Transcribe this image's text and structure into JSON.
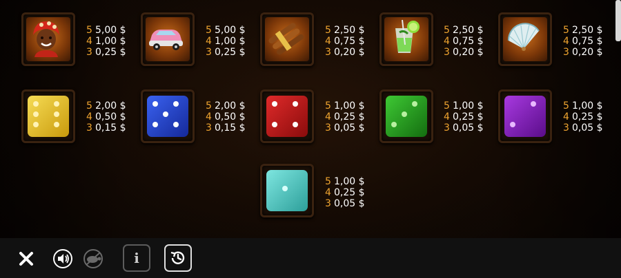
{
  "paytable": {
    "symbols": [
      {
        "id": "woman",
        "payouts": [
          {
            "count": "5",
            "value": "5,00 $"
          },
          {
            "count": "4",
            "value": "1,00 $"
          },
          {
            "count": "3",
            "value": "0,25 $"
          }
        ]
      },
      {
        "id": "car",
        "payouts": [
          {
            "count": "5",
            "value": "5,00 $"
          },
          {
            "count": "4",
            "value": "1,00 $"
          },
          {
            "count": "3",
            "value": "0,25 $"
          }
        ]
      },
      {
        "id": "cigars",
        "payouts": [
          {
            "count": "5",
            "value": "2,50 $"
          },
          {
            "count": "4",
            "value": "0,75 $"
          },
          {
            "count": "3",
            "value": "0,20 $"
          }
        ]
      },
      {
        "id": "mojito",
        "payouts": [
          {
            "count": "5",
            "value": "2,50 $"
          },
          {
            "count": "4",
            "value": "0,75 $"
          },
          {
            "count": "3",
            "value": "0,20 $"
          }
        ]
      },
      {
        "id": "fan",
        "payouts": [
          {
            "count": "5",
            "value": "2,50 $"
          },
          {
            "count": "4",
            "value": "0,75 $"
          },
          {
            "count": "3",
            "value": "0,20 $"
          }
        ]
      },
      {
        "id": "die-yellow",
        "color": "#e8c21a",
        "payouts": [
          {
            "count": "5",
            "value": "2,00 $"
          },
          {
            "count": "4",
            "value": "0,50 $"
          },
          {
            "count": "3",
            "value": "0,15 $"
          }
        ]
      },
      {
        "id": "die-blue",
        "color": "#1e3fc8",
        "payouts": [
          {
            "count": "5",
            "value": "2,00 $"
          },
          {
            "count": "4",
            "value": "0,50 $"
          },
          {
            "count": "3",
            "value": "0,15 $"
          }
        ]
      },
      {
        "id": "die-red",
        "color": "#b81515",
        "payouts": [
          {
            "count": "5",
            "value": "1,00 $"
          },
          {
            "count": "4",
            "value": "0,25 $"
          },
          {
            "count": "3",
            "value": "0,05 $"
          }
        ]
      },
      {
        "id": "die-green",
        "color": "#22a81d",
        "payouts": [
          {
            "count": "5",
            "value": "1,00 $"
          },
          {
            "count": "4",
            "value": "0,25 $"
          },
          {
            "count": "3",
            "value": "0,05 $"
          }
        ]
      },
      {
        "id": "die-purple",
        "color": "#8d1fc0",
        "payouts": [
          {
            "count": "5",
            "value": "1,00 $"
          },
          {
            "count": "4",
            "value": "0,25 $"
          },
          {
            "count": "3",
            "value": "0,05 $"
          }
        ]
      },
      {
        "id": "die-cyan",
        "color": "#52cfc9",
        "payouts": [
          {
            "count": "5",
            "value": "1,00 $"
          },
          {
            "count": "4",
            "value": "0,25 $"
          },
          {
            "count": "3",
            "value": "0,05 $"
          }
        ]
      }
    ]
  },
  "toolbar": {
    "buttons": [
      "close-icon",
      "sound-icon",
      "turbo-icon",
      "info-icon",
      "history-icon"
    ]
  },
  "colors": {
    "count": "#f0a530",
    "value": "#ffffff",
    "bar": "#111111"
  }
}
